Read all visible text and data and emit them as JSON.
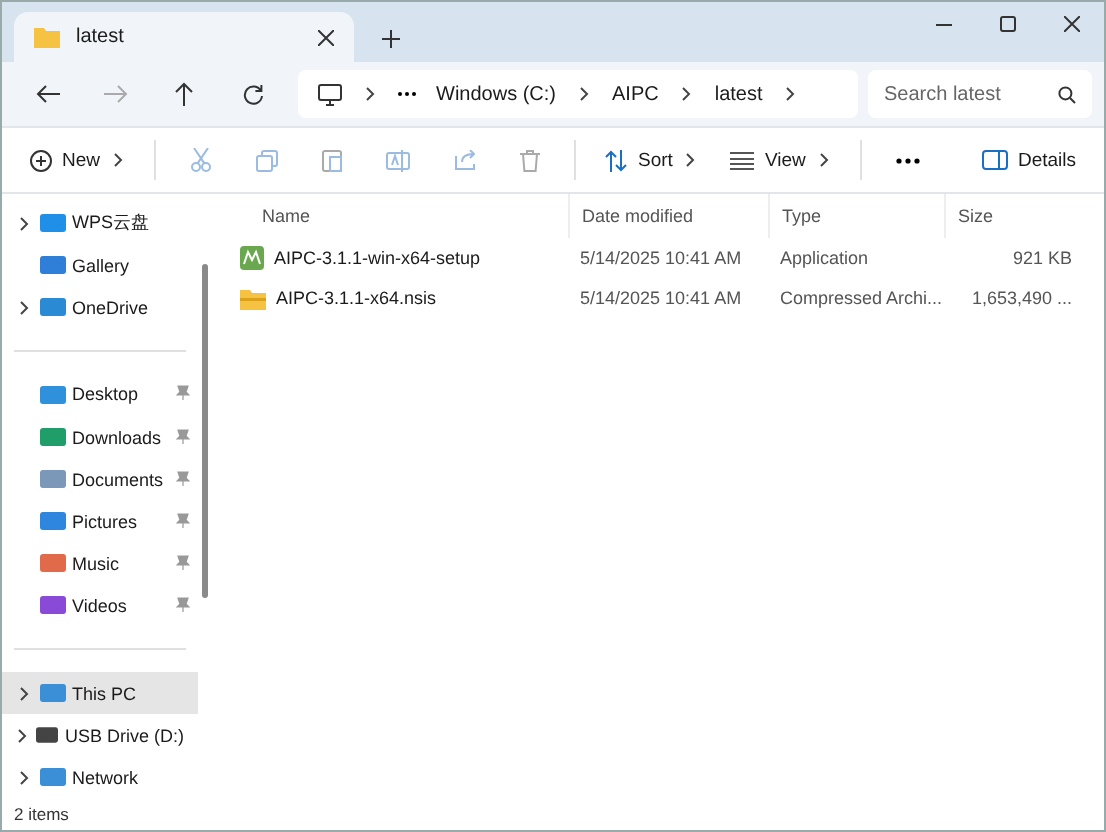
{
  "window": {
    "tab_title": "latest"
  },
  "address": {
    "segments": [
      "Windows (C:)",
      "AIPC",
      "latest"
    ],
    "search_placeholder": "Search latest"
  },
  "toolbar": {
    "new_label": "New",
    "sort_label": "Sort",
    "view_label": "View",
    "details_label": "Details"
  },
  "sidebar": {
    "sections": [
      {
        "items": [
          {
            "label": "WPS云盘",
            "expandable": true,
            "pinned": false,
            "selected": false
          },
          {
            "label": "Gallery",
            "expandable": false,
            "pinned": false,
            "selected": false
          },
          {
            "label": "OneDrive",
            "expandable": true,
            "pinned": false,
            "selected": false
          }
        ]
      },
      {
        "items": [
          {
            "label": "Desktop",
            "expandable": false,
            "pinned": true,
            "selected": false
          },
          {
            "label": "Downloads",
            "expandable": false,
            "pinned": true,
            "selected": false
          },
          {
            "label": "Documents",
            "expandable": false,
            "pinned": true,
            "selected": false
          },
          {
            "label": "Pictures",
            "expandable": false,
            "pinned": true,
            "selected": false
          },
          {
            "label": "Music",
            "expandable": false,
            "pinned": true,
            "selected": false
          },
          {
            "label": "Videos",
            "expandable": false,
            "pinned": true,
            "selected": false
          }
        ]
      },
      {
        "items": [
          {
            "label": "This PC",
            "expandable": true,
            "pinned": false,
            "selected": true
          },
          {
            "label": "USB Drive (D:)",
            "expandable": true,
            "pinned": false,
            "selected": false
          },
          {
            "label": "Network",
            "expandable": true,
            "pinned": false,
            "selected": false
          }
        ]
      }
    ]
  },
  "table": {
    "columns": [
      "Name",
      "Date modified",
      "Type",
      "Size"
    ],
    "rows": [
      {
        "kind": "app",
        "name": "AIPC-3.1.1-win-x64-setup",
        "date": "5/14/2025 10:41 AM",
        "type": "Application",
        "size": "921 KB",
        "selected": false
      },
      {
        "kind": "archive",
        "name": "AIPC-3.1.1-x64.nsis",
        "date": "5/14/2025 10:41 AM",
        "type": "Compressed Archi...",
        "size": "1,653,490 ...",
        "selected": false
      }
    ]
  },
  "status_bar": {
    "count": "2 items"
  }
}
